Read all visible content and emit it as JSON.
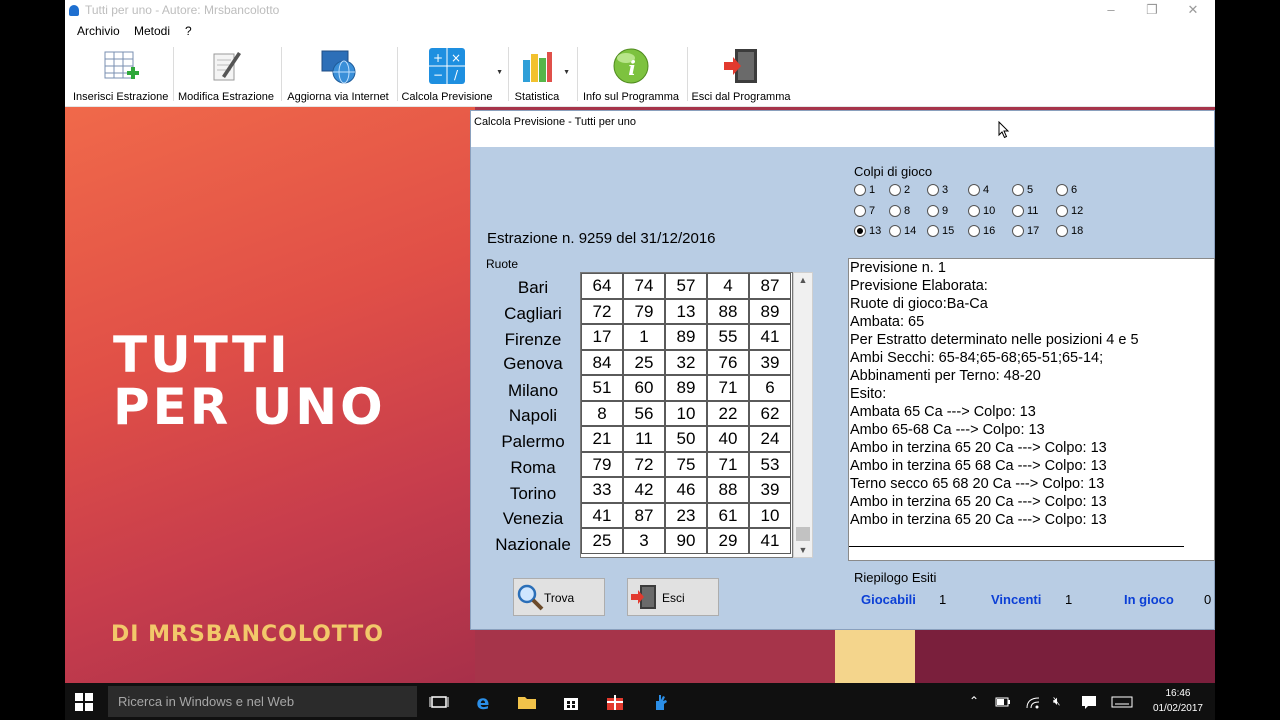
{
  "window": {
    "title": "Tutti per uno - Autore: Mrsbancolotto",
    "controls": {
      "minimize": "–",
      "maximize": "❐",
      "close": "✕"
    }
  },
  "menu": [
    "Archivio",
    "Metodi",
    "?"
  ],
  "toolbar": [
    {
      "label": "Inserisci Estrazione",
      "icon": "table-add-icon"
    },
    {
      "label": "Modifica Estrazione",
      "icon": "edit-pencil-icon"
    },
    {
      "label": "Aggiorna via Internet",
      "icon": "globe-update-icon"
    },
    {
      "label": "Calcola Previsione",
      "icon": "calculator-icon"
    },
    {
      "label": "Statistica",
      "icon": "bar-chart-icon"
    },
    {
      "label": "Info sul Programma",
      "icon": "info-icon"
    },
    {
      "label": "Esci dal Programma",
      "icon": "exit-door-icon"
    }
  ],
  "background": {
    "title_line1": "TUTTI",
    "title_line2": "PER UNO",
    "subtitle": "DI MRSBANCOLOTTO"
  },
  "dialog": {
    "title": "Calcola Previsione - Tutti per uno",
    "estrazione": "Estrazione n. 9259 del 31/12/2016",
    "ruote_label": "Ruote",
    "wheels": [
      {
        "name": "Bari",
        "numbers": [
          "64",
          "74",
          "57",
          "4",
          "87"
        ]
      },
      {
        "name": "Cagliari",
        "numbers": [
          "72",
          "79",
          "13",
          "88",
          "89"
        ]
      },
      {
        "name": "Firenze",
        "numbers": [
          "17",
          "1",
          "89",
          "55",
          "41"
        ]
      },
      {
        "name": "Genova",
        "numbers": [
          "84",
          "25",
          "32",
          "76",
          "39"
        ]
      },
      {
        "name": "Milano",
        "numbers": [
          "51",
          "60",
          "89",
          "71",
          "6"
        ]
      },
      {
        "name": "Napoli",
        "numbers": [
          "8",
          "56",
          "10",
          "22",
          "62"
        ]
      },
      {
        "name": "Palermo",
        "numbers": [
          "21",
          "11",
          "50",
          "40",
          "24"
        ]
      },
      {
        "name": "Roma",
        "numbers": [
          "79",
          "72",
          "75",
          "71",
          "53"
        ]
      },
      {
        "name": "Torino",
        "numbers": [
          "33",
          "42",
          "46",
          "88",
          "39"
        ]
      },
      {
        "name": "Venezia",
        "numbers": [
          "41",
          "87",
          "23",
          "61",
          "10"
        ]
      },
      {
        "name": "Nazionale",
        "numbers": [
          "25",
          "3",
          "90",
          "29",
          "41"
        ]
      }
    ],
    "buttons": {
      "trova": "Trova",
      "esci": "Esci"
    },
    "colpi_label": "Colpi di gioco",
    "colpi": [
      "1",
      "2",
      "3",
      "4",
      "5",
      "6",
      "7",
      "8",
      "9",
      "10",
      "11",
      "12",
      "13",
      "14",
      "15",
      "16",
      "17",
      "18"
    ],
    "colpi_selected": "13",
    "result_lines": [
      "Previsione n. 1",
      "Previsione Elaborata:",
      "Ruote di gioco:Ba-Ca",
      "Ambata: 65",
      "Per Estratto determinato nelle posizioni 4 e 5",
      "Ambi Secchi: 65-84;65-68;65-51;65-14;",
      "Abbinamenti per Terno: 48-20",
      "Esito:",
      "Ambata 65 Ca ---> Colpo: 13",
      "Ambo 65-68 Ca ---> Colpo: 13",
      "Ambo in terzina 65 20 Ca ---> Colpo: 13",
      "Ambo in terzina 65 68 Ca ---> Colpo: 13",
      "Terno secco 65 68 20 Ca ---> Colpo: 13",
      "Ambo in terzina 65 20 Ca ---> Colpo: 13",
      "Ambo in terzina 65 20 Ca ---> Colpo: 13"
    ],
    "riepilogo_label": "Riepilogo Esiti",
    "riepilogo": {
      "giocabili_label": "Giocabili",
      "giocabili": "1",
      "vincenti_label": "Vincenti",
      "vincenti": "1",
      "ingioco_label": "In gioco",
      "ingioco": "0"
    }
  },
  "taskbar": {
    "search_placeholder": "Ricerca in Windows e nel Web",
    "time": "16:46",
    "date": "01/02/2017"
  }
}
